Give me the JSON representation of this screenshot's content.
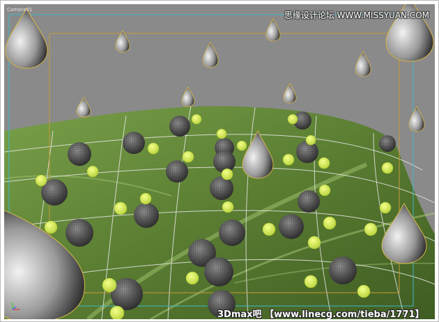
{
  "viewport": {
    "label": "Camera01",
    "background_color": "#8a8a8a",
    "safe_frame_outer_color": "#3fb7c9",
    "safe_frame_inner_color": "#c89a3a",
    "leaf_color": "#5e7f35",
    "drop_color": "#d9b84a"
  },
  "branding": {
    "site_name": "思缘设计论坛",
    "site_url": "WWW.MISSYUAN.COM"
  },
  "watermark": {
    "text": "3Dmax吧 【www.linecg.com/tieba/1771】"
  },
  "axis_icon": "axis-tripod-icon"
}
